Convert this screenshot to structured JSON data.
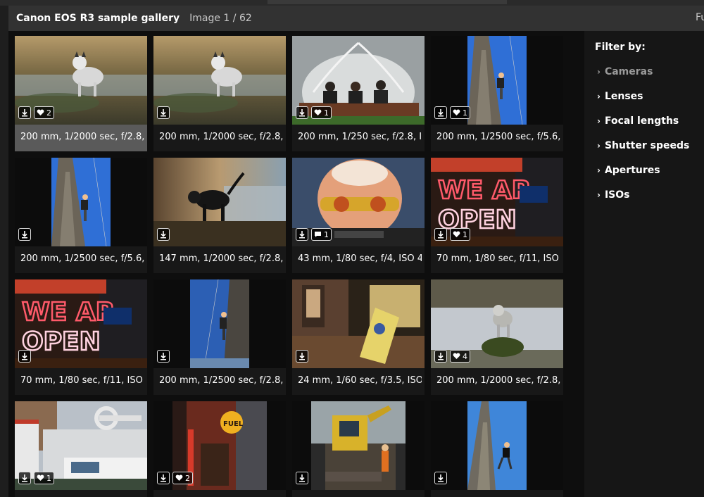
{
  "header": {
    "title": "Canon EOS R3 sample gallery",
    "counter": "Image 1 / 62",
    "fullscreen_label": "Full screen"
  },
  "sidebar": {
    "title": "Filter by:",
    "items": [
      {
        "label": "Cameras",
        "dim": true
      },
      {
        "label": "Lenses",
        "dim": false
      },
      {
        "label": "Focal lengths",
        "dim": false
      },
      {
        "label": "Shutter speeds",
        "dim": false
      },
      {
        "label": "Apertures",
        "dim": false
      },
      {
        "label": "ISOs",
        "dim": false
      }
    ]
  },
  "tiles": [
    {
      "caption": "200 mm, 1/2000 sec, f/2.8,",
      "likes": "2",
      "selected": true,
      "scene": "dog",
      "crop": "full"
    },
    {
      "caption": "200 mm, 1/2000 sec, f/2.8,",
      "likes": "",
      "selected": false,
      "scene": "dog",
      "crop": "full"
    },
    {
      "caption": "200 mm, 1/250 sec, f/2.8, I",
      "likes": "1",
      "selected": false,
      "scene": "fountain",
      "crop": "full"
    },
    {
      "caption": "200 mm, 1/2500 sec, f/5.6,",
      "likes": "1",
      "selected": false,
      "scene": "climber",
      "crop": "narrow"
    },
    {
      "caption": "200 mm, 1/2500 sec, f/5.6,",
      "likes": "",
      "selected": false,
      "scene": "climber",
      "crop": "narrow"
    },
    {
      "caption": "147 mm, 1/2000 sec, f/2.8,",
      "likes": "",
      "selected": false,
      "scene": "blackdog",
      "crop": "full"
    },
    {
      "caption": "43 mm, 1/80 sec, f/4, ISO 4",
      "likes": "1",
      "selected": false,
      "scene": "mural",
      "crop": "full"
    },
    {
      "caption": "70 mm, 1/80 sec, f/11, ISO",
      "likes": "1",
      "selected": false,
      "scene": "neon",
      "crop": "full"
    },
    {
      "caption": "70 mm, 1/80 sec, f/11, ISO",
      "likes": "",
      "selected": false,
      "scene": "neon",
      "crop": "full"
    },
    {
      "caption": "200 mm, 1/2500 sec, f/2.8,",
      "likes": "",
      "selected": false,
      "scene": "climber2",
      "crop": "narrow"
    },
    {
      "caption": "24 mm, 1/60 sec, f/3.5, ISO",
      "likes": "",
      "selected": false,
      "scene": "shop",
      "crop": "full"
    },
    {
      "caption": "200 mm, 1/2000 sec, f/2.8,",
      "likes": "4",
      "selected": false,
      "scene": "rockdog",
      "crop": "full"
    },
    {
      "caption": "",
      "likes": "1",
      "selected": false,
      "scene": "industrial",
      "crop": "full"
    },
    {
      "caption": "",
      "likes": "2",
      "selected": false,
      "scene": "fuel",
      "crop": "mid"
    },
    {
      "caption": "",
      "likes": "",
      "selected": false,
      "scene": "excavator",
      "crop": "mid"
    },
    {
      "caption": "",
      "likes": "",
      "selected": false,
      "scene": "climber3",
      "crop": "narrow"
    }
  ]
}
